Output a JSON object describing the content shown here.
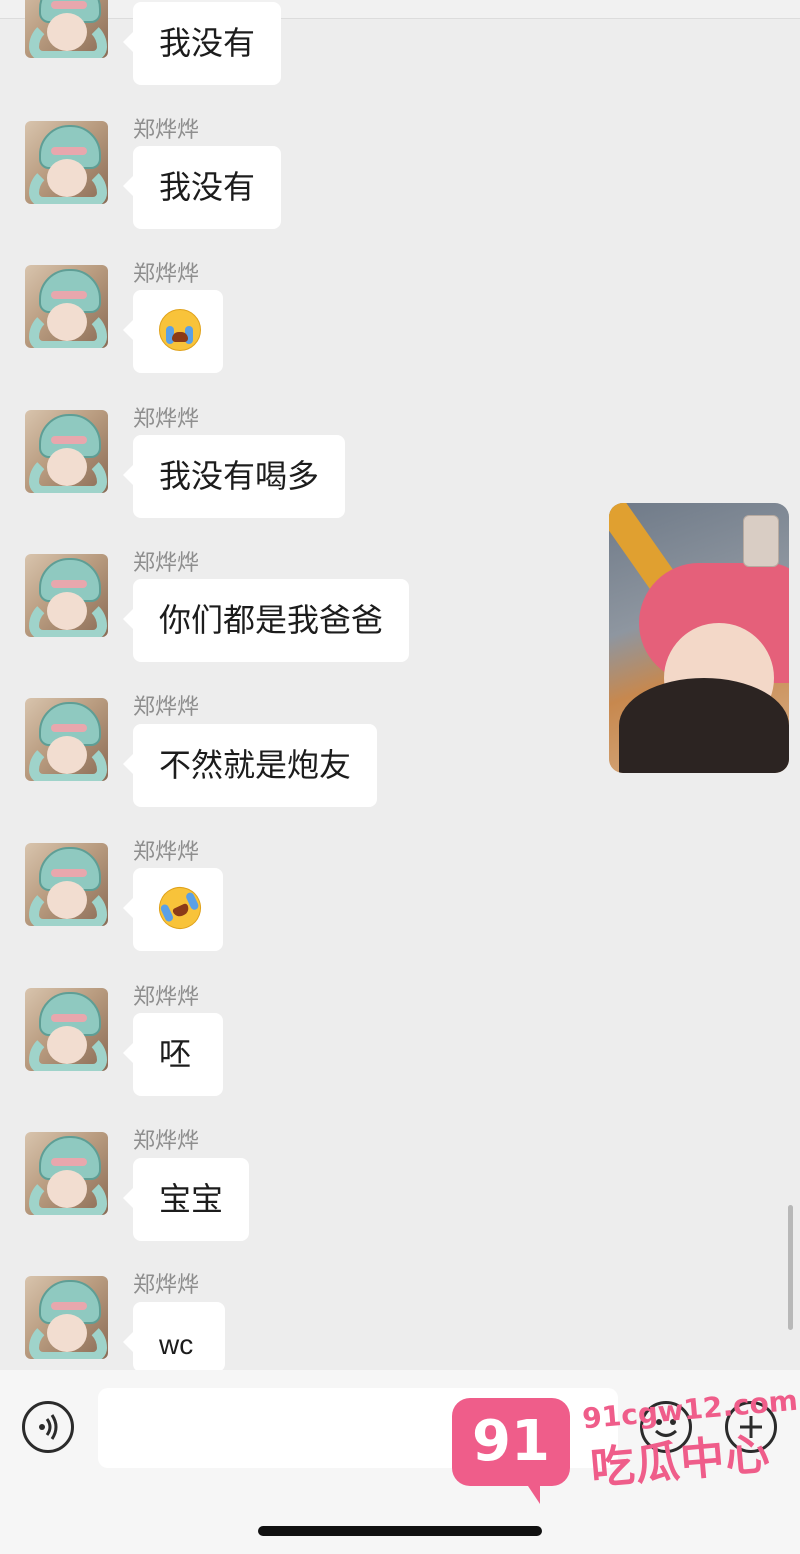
{
  "chat": {
    "messages": [
      {
        "sender": "",
        "kind": "text",
        "text": "我没有"
      },
      {
        "sender": "郑烨烨",
        "kind": "text",
        "text": "我没有"
      },
      {
        "sender": "郑烨烨",
        "kind": "emoji",
        "emoji": "crying-emoji"
      },
      {
        "sender": "郑烨烨",
        "kind": "text",
        "text": "我没有喝多"
      },
      {
        "sender": "郑烨烨",
        "kind": "text",
        "text": "你们都是我爸爸"
      },
      {
        "sender": "郑烨烨",
        "kind": "text",
        "text": "不然就是炮友"
      },
      {
        "sender": "郑烨烨",
        "kind": "emoji",
        "emoji": "rolling-laughing-emoji"
      },
      {
        "sender": "郑烨烨",
        "kind": "text",
        "text": "呸"
      },
      {
        "sender": "郑烨烨",
        "kind": "text",
        "text": "宝宝"
      },
      {
        "sender": "郑烨烨",
        "kind": "text",
        "text": "wc"
      }
    ]
  },
  "input_bar": {
    "voice_icon": "voice-icon",
    "emoji_icon": "emoji-face-icon",
    "plus_icon": "plus-icon",
    "text_value": ""
  },
  "watermark": {
    "badge": "91",
    "url": "91cgw12.com",
    "text": "吃瓜中心",
    "color": "#ef5d8a"
  },
  "colors": {
    "background": "#ededed",
    "bubble": "#ffffff",
    "sender_name": "#8e8e8e"
  }
}
